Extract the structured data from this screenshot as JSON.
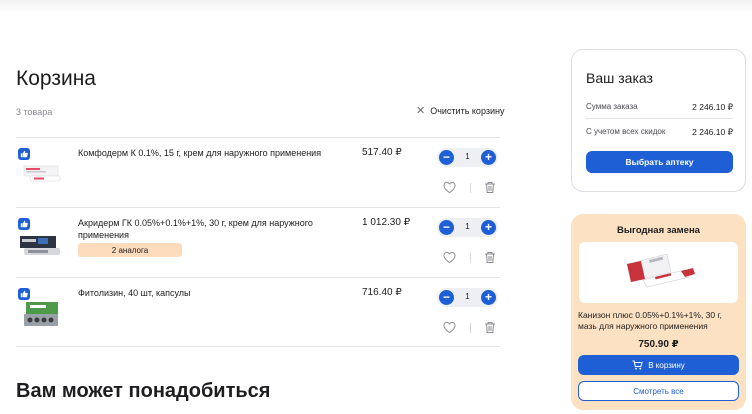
{
  "cart": {
    "title": "Корзина",
    "count_text": "3 товара",
    "clear_label": "Очистить корзину",
    "items": [
      {
        "name": "Комфодерм К 0.1%, 15 г, крем для наружного применения",
        "price": "517.40 ₽",
        "qty": "1",
        "analogs": ""
      },
      {
        "name": "Акридерм ГК 0.05%+0.1%+1%, 30 г, крем для наружного применения",
        "price": "1 012.30 ₽",
        "qty": "1",
        "analogs": "2 аналога"
      },
      {
        "name": "Фитолизин, 40 шт, капсулы",
        "price": "716.40 ₽",
        "qty": "1",
        "analogs": ""
      }
    ]
  },
  "recommend": {
    "title": "Вам может понадобиться"
  },
  "order": {
    "title": "Ваш заказ",
    "sum_label": "Сумма заказа",
    "sum_value": "2 246.10 ₽",
    "discount_label": "С учетом всех скидок",
    "discount_value": "2 246.10 ₽",
    "button_label": "Выбрать аптеку"
  },
  "replacement": {
    "title": "Выгодная замена",
    "name": "Канизон плюс 0.05%+0.1%+1%, 30 г, мазь для наружного применения",
    "price": "750.90 ₽",
    "cart_button": "В корзину",
    "all_button": "Смотреть все"
  },
  "colors": {
    "accent": "#1f5fd6",
    "highlight": "#fde1c3",
    "analog_badge": "#fcdcbc"
  },
  "icons": {
    "clear": "close-icon",
    "like": "thumb-up-icon",
    "favorite": "heart-icon",
    "delete": "trash-icon",
    "cart": "cart-icon"
  }
}
